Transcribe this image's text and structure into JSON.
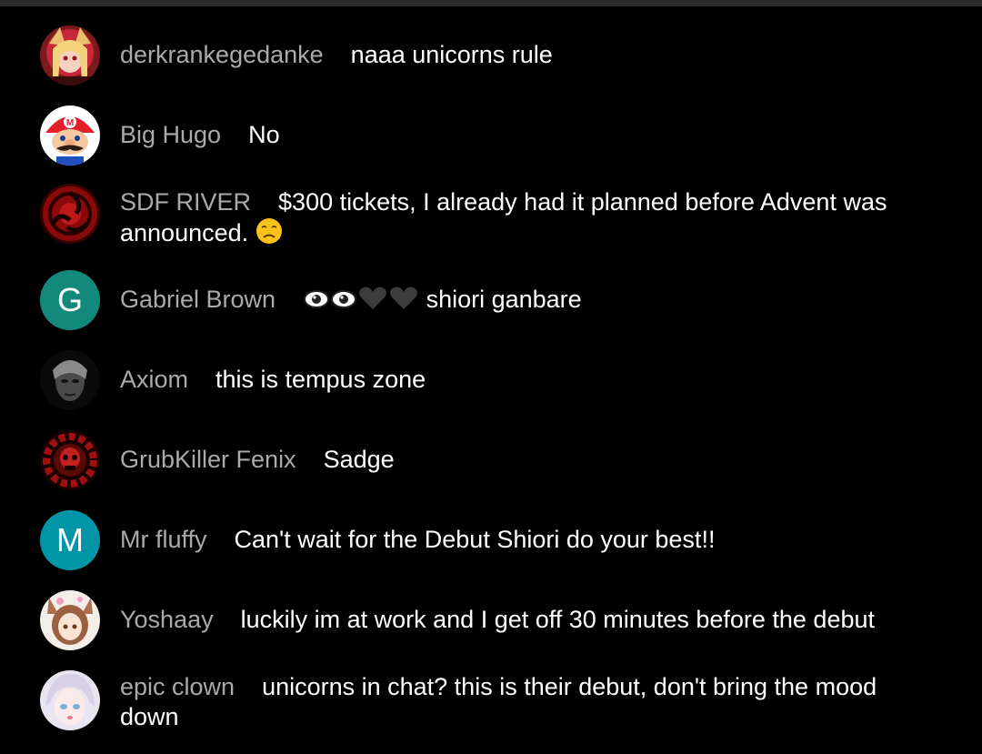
{
  "colors": {
    "background": "#000000",
    "author": "#aaaaaa",
    "message": "#ffffff",
    "avatar_g": "#13897c",
    "avatar_m": "#0096a8"
  },
  "messages": [
    {
      "author": "derkrankegedanke",
      "text": "naaa unicorns rule",
      "avatar": "anime-girl-avatar"
    },
    {
      "author": "Big Hugo",
      "text": "No",
      "avatar": "mario-avatar"
    },
    {
      "author": "SDF RIVER",
      "text": "$300 tickets, I already had it planned before Advent was announced. ",
      "emoji": "disappointed-face-emoji",
      "avatar": "red-swirl-avatar"
    },
    {
      "author": "Gabriel Brown",
      "emoji_prefix": "👁👁🖤🖤",
      "text": " shiori ganbare",
      "avatar_letter": "G"
    },
    {
      "author": "Axiom",
      "text": "this is tempus zone",
      "avatar": "dark-face-avatar"
    },
    {
      "author": "GrubKiller Fenix",
      "text": "Sadge",
      "avatar": "red-gear-skull-avatar"
    },
    {
      "author": "Mr fluffy",
      "text": "Can't wait for the Debut Shiori do your best!!",
      "avatar_letter": "M"
    },
    {
      "author": "Yoshaay",
      "text": "luckily im at work and I get off 30 minutes before the debut",
      "avatar": "anime-foxgirl-avatar"
    },
    {
      "author": "epic clown",
      "text": "unicorns in chat? this is their debut, don't bring the mood down",
      "avatar": "white-hair-anime-avatar"
    }
  ]
}
